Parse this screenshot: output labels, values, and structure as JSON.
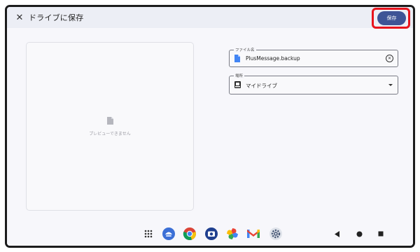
{
  "appbar": {
    "close_glyph": "✕",
    "title": "ドライブに保存",
    "save_label": "保存",
    "accent_color": "#3e5496",
    "highlight_color": "#e8141d"
  },
  "preview": {
    "message": "プレビューできません",
    "icon": "document-icon"
  },
  "fields": {
    "filename": {
      "label": "ファイル名",
      "value": "PlusMessage.backup",
      "icon": "file-icon",
      "clear_icon": "clear-circle-icon"
    },
    "location": {
      "label": "場所",
      "value": "マイドライブ",
      "icon": "drive-icon",
      "dropdown_icon": "dropdown-arrow-icon"
    }
  },
  "navbar": {
    "apps": [
      "app-drawer-icon",
      "messenger-app-icon",
      "chrome-icon",
      "camera-icon",
      "photos-icon",
      "gmail-icon",
      "settings-icon"
    ],
    "controls": [
      "back-icon",
      "home-icon",
      "recents-icon"
    ]
  }
}
